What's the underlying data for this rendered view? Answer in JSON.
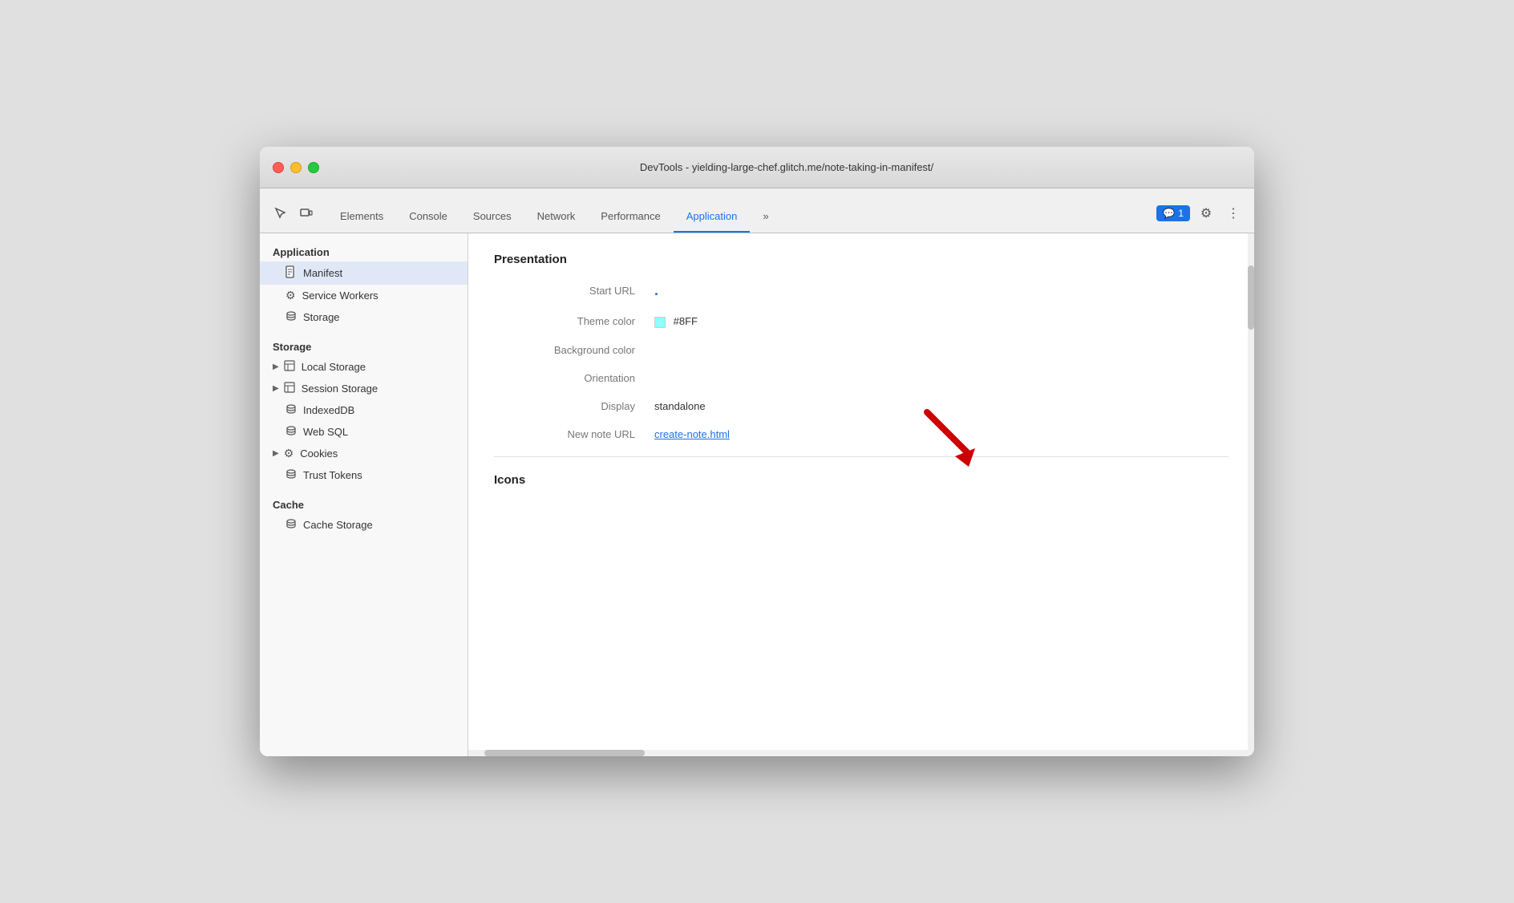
{
  "window": {
    "title": "DevTools - yielding-large-chef.glitch.me/note-taking-in-manifest/"
  },
  "traffic_lights": {
    "red_label": "close",
    "yellow_label": "minimize",
    "green_label": "maximize"
  },
  "toolbar": {
    "inspect_icon": "⊹",
    "device_icon": "⧉",
    "tabs": [
      {
        "id": "elements",
        "label": "Elements",
        "active": false
      },
      {
        "id": "console",
        "label": "Console",
        "active": false
      },
      {
        "id": "sources",
        "label": "Sources",
        "active": false
      },
      {
        "id": "network",
        "label": "Network",
        "active": false
      },
      {
        "id": "performance",
        "label": "Performance",
        "active": false
      },
      {
        "id": "application",
        "label": "Application",
        "active": true
      }
    ],
    "more_tabs_icon": "»",
    "badge_icon": "💬",
    "badge_count": "1",
    "settings_icon": "⚙",
    "more_icon": "⋮"
  },
  "sidebar": {
    "application_section": "Application",
    "application_items": [
      {
        "id": "manifest",
        "label": "Manifest",
        "icon": "📄",
        "active": true
      },
      {
        "id": "service-workers",
        "label": "Service Workers",
        "icon": "⚙"
      },
      {
        "id": "storage",
        "label": "Storage",
        "icon": "🗄"
      }
    ],
    "storage_section": "Storage",
    "storage_items": [
      {
        "id": "local-storage",
        "label": "Local Storage",
        "icon": "▦",
        "expandable": true
      },
      {
        "id": "session-storage",
        "label": "Session Storage",
        "icon": "▦",
        "expandable": true
      },
      {
        "id": "indexeddb",
        "label": "IndexedDB",
        "icon": "🗄",
        "expandable": false
      },
      {
        "id": "web-sql",
        "label": "Web SQL",
        "icon": "🗄",
        "expandable": false
      },
      {
        "id": "cookies",
        "label": "Cookies",
        "icon": "⚙",
        "expandable": true
      },
      {
        "id": "trust-tokens",
        "label": "Trust Tokens",
        "icon": "🗄",
        "expandable": false
      }
    ],
    "cache_section": "Cache",
    "cache_items": [
      {
        "id": "cache-storage",
        "label": "Cache Storage",
        "icon": "🗄",
        "expandable": false
      }
    ]
  },
  "panel": {
    "presentation_title": "Presentation",
    "fields": [
      {
        "id": "start-url",
        "label": "Start URL",
        "value": ".",
        "type": "dot"
      },
      {
        "id": "theme-color",
        "label": "Theme color",
        "value": "#8FF",
        "type": "color",
        "color": "#8FFFFF"
      },
      {
        "id": "background-color",
        "label": "Background color",
        "value": "",
        "type": "text"
      },
      {
        "id": "orientation",
        "label": "Orientation",
        "value": "",
        "type": "text"
      },
      {
        "id": "display",
        "label": "Display",
        "value": "standalone",
        "type": "text"
      },
      {
        "id": "new-note-url",
        "label": "New note URL",
        "value": "create-note.html",
        "type": "link"
      }
    ],
    "icons_title": "Icons"
  }
}
